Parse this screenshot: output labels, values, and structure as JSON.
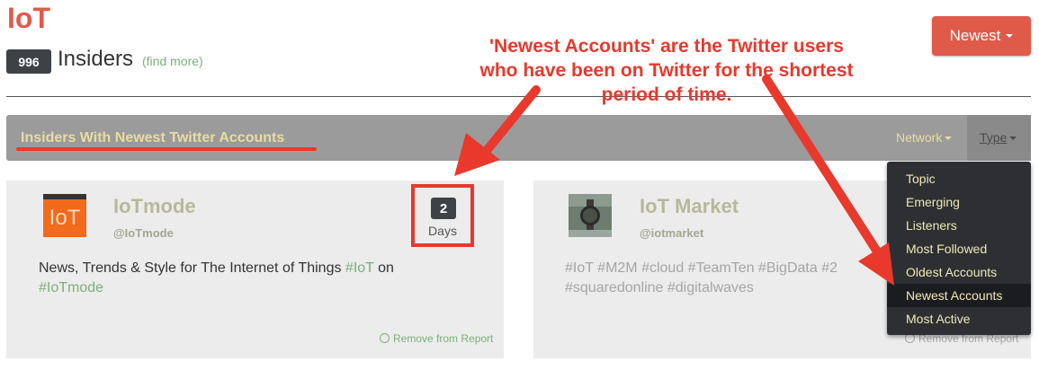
{
  "header": {
    "title": "IoT",
    "insider_count": "996",
    "insiders_label": "Insiders",
    "find_more": "(find more)",
    "sort_button": "Newest"
  },
  "section": {
    "title": "Insiders With Newest Twitter Accounts",
    "network_label": "Network",
    "type_label": "Type"
  },
  "menu": {
    "items": [
      "Topic",
      "Emerging",
      "Listeners",
      "Most Followed",
      "Oldest Accounts",
      "Newest Accounts",
      "Most Active"
    ],
    "active": "Newest Accounts"
  },
  "cards": [
    {
      "name": "IoTmode",
      "handle": "@IoTmode",
      "avatar_text": "IoT",
      "days_value": "2",
      "days_label": "Days",
      "desc_text": "News, Trends & Style for The Internet of Things",
      "desc_tag1": "#IoT",
      "desc_mid": " on",
      "desc_tag2": "#IoTmode",
      "remove": "Remove from Report"
    },
    {
      "name": "IoT Market",
      "handle": "@iotmarket",
      "desc_line1": "#IoT #M2M #cloud #TeamTen #BigData #2",
      "desc_line2": "#squaredonline #digitalwaves",
      "remove": "Remove from Report"
    }
  ],
  "annotation": {
    "line1": "'Newest Accounts' are the Twitter users",
    "line2": "who have been on Twitter for the shortest",
    "line3": "period of time."
  },
  "colors": {
    "brand": "#e05a4a",
    "annotation": "#e8392c",
    "link": "#7bb07a",
    "bar": "#9b9b9b",
    "menu_bg": "#2d2f33"
  }
}
